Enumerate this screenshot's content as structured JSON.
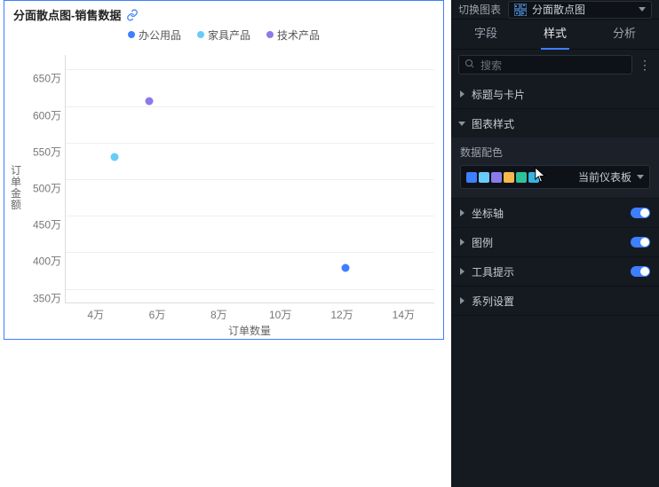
{
  "chart_card": {
    "title": "分面散点图-销售数据",
    "link_icon": "link-icon"
  },
  "chart_data": {
    "type": "scatter",
    "title": "分面散点图-销售数据",
    "xlabel": "订单数量",
    "ylabel": "订单金额",
    "xlim_wan": [
      3,
      15
    ],
    "ylim_wan": [
      330,
      670
    ],
    "xticks": [
      "4万",
      "6万",
      "8万",
      "10万",
      "12万",
      "14万"
    ],
    "yticks": [
      "650万",
      "600万",
      "550万",
      "500万",
      "450万",
      "400万",
      "350万"
    ],
    "series": [
      {
        "name": "办公用品",
        "color": "#3d7fff",
        "points": [
          {
            "x_wan": 12.1,
            "y_wan": 378
          }
        ]
      },
      {
        "name": "家具产品",
        "color": "#68cbf8",
        "points": [
          {
            "x_wan": 4.6,
            "y_wan": 530
          }
        ]
      },
      {
        "name": "技术产品",
        "color": "#8b7bea",
        "points": [
          {
            "x_wan": 5.7,
            "y_wan": 607
          }
        ]
      }
    ]
  },
  "panel": {
    "switch_label": "切换图表",
    "chart_type": "分面散点图",
    "tabs": [
      "字段",
      "样式",
      "分析"
    ],
    "active_tab_index": 1,
    "search_placeholder": "搜索",
    "sections": {
      "title_card": {
        "label": "标题与卡片"
      },
      "chart_style": {
        "label": "图表样式"
      },
      "axes": {
        "label": "坐标轴",
        "toggle": true
      },
      "legend": {
        "label": "图例",
        "toggle": true
      },
      "tooltip": {
        "label": "工具提示",
        "toggle": true
      },
      "series_cfg": {
        "label": "系列设置"
      }
    },
    "color_block": {
      "label": "数据配色",
      "swatches": [
        "#3d7fff",
        "#68cbf8",
        "#8b7bea",
        "#f6b94b",
        "#2fc29a",
        "#36b5e0"
      ],
      "scope_label": "当前仪表板"
    }
  }
}
